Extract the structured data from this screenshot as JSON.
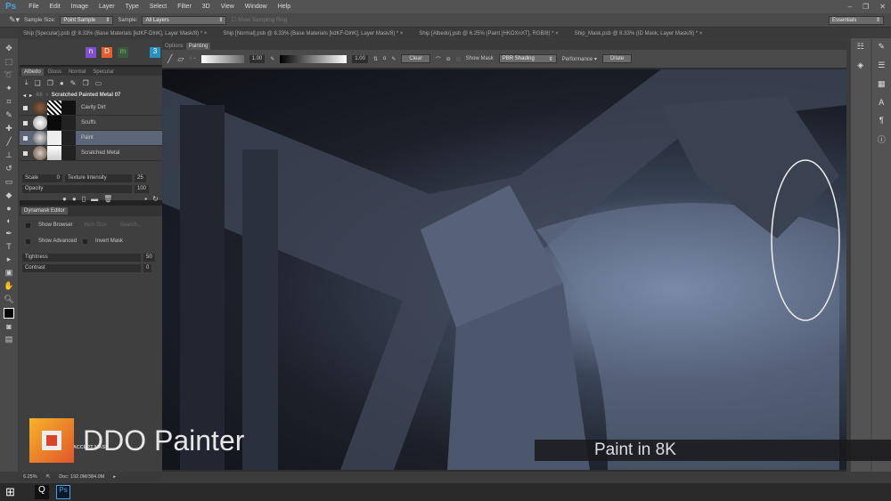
{
  "app": {
    "logo": "Ps",
    "menu": [
      "File",
      "Edit",
      "Image",
      "Layer",
      "Type",
      "Select",
      "Filter",
      "3D",
      "View",
      "Window",
      "Help"
    ]
  },
  "options": {
    "sample_size_label": "Sample Size:",
    "sample_size": "Point Sample",
    "sample_label": "Sample:",
    "sample": "All Layers",
    "sampling_ring": "Show Sampling Ring",
    "workspace": "Essentials"
  },
  "doc_tabs": [
    "Ship [Specular].psb @ 8.33% (Base Materials [kdKF-DlnK], Layer Mask/8) *",
    "Ship [Normal].psb @ 8.33% (Base Materials [kdKF-DlnK], Layer Mask/8) *",
    "Ship [Albedo].psb @ 6.25% (Paint [HKOXnXT], RGB/8) *",
    "Ship_Mask.psb @ 8.33% (ID Mask, Layer Mask/8) *"
  ],
  "plugins": [
    "n",
    "D",
    "m",
    "3"
  ],
  "panel": {
    "tabs": [
      "Albedo",
      "Gloss",
      "Normal",
      "Specular"
    ],
    "breadcrumb_all": "All",
    "material": "Scratched Painted Metal 07",
    "layers": [
      {
        "name": "Cavity Dirt"
      },
      {
        "name": "Scuffs"
      },
      {
        "name": "Paint"
      },
      {
        "name": "Scratched Metal"
      }
    ],
    "scale_label": "Scale",
    "scale": "0",
    "tex_label": "Texture Intensity",
    "tex": "25",
    "opacity_label": "Opacity",
    "opacity": "100"
  },
  "dynamask": {
    "title": "Dynamask Editor",
    "show_browser": "Show Browser",
    "item_size": "Item Size",
    "search": "Search...",
    "show_advanced": "Show Advanced",
    "invert_mask": "Invert Mask",
    "tightness_label": "Tightness",
    "tightness": "50",
    "contrast_label": "Contrast",
    "contrast": "0",
    "accept": "ACCEPT MASK"
  },
  "viewport": {
    "tabs": [
      "Options",
      "Painting"
    ],
    "val1": "1.00",
    "val2": "1.00",
    "clear": "Clear",
    "show_mask": "Show Mask",
    "shading": "PBR Shading",
    "performance": "Performance",
    "dilate": "Dilate"
  },
  "status": {
    "zoom": "6.25%",
    "doc": "Doc: 192.0M/384.0M"
  },
  "brand": {
    "name": "DDO Painter",
    "tagline": "Paint in 8K"
  },
  "taskbar": {
    "ps": "Ps"
  }
}
